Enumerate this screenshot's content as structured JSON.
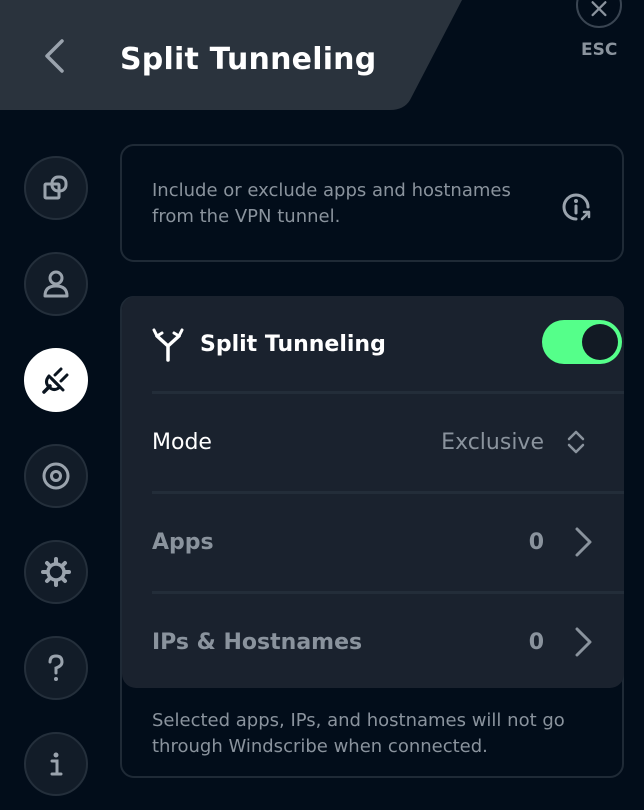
{
  "header": {
    "title": "Split Tunneling",
    "esc_label": "ESC",
    "back_icon": "chevron-left-icon",
    "close_icon": "close-icon"
  },
  "sidebar": {
    "items": [
      {
        "id": "connection",
        "icon": "windows-stack-icon",
        "active": false
      },
      {
        "id": "account",
        "icon": "user-icon",
        "active": false
      },
      {
        "id": "connection-settings",
        "icon": "plug-icon",
        "active": true
      },
      {
        "id": "robert",
        "icon": "robert-icon",
        "active": false
      },
      {
        "id": "general",
        "icon": "gear-icon",
        "active": false
      },
      {
        "id": "help",
        "icon": "question-icon",
        "active": false
      },
      {
        "id": "about",
        "icon": "info-icon",
        "active": false
      }
    ]
  },
  "info": {
    "text": "Include or exclude apps and hostnames from the VPN tunnel.",
    "icon": "info-external-icon"
  },
  "split_tunneling": {
    "title": "Split Tunneling",
    "enabled": true,
    "toggle_color": "#55ff8a",
    "mode_label": "Mode",
    "mode_value": "Exclusive",
    "apps_label": "Apps",
    "apps_count": "0",
    "hosts_label": "IPs & Hostnames",
    "hosts_count": "0"
  },
  "footer": {
    "note": "Selected apps, IPs, and hostnames will not go through Windscribe when connected."
  },
  "colors": {
    "background": "#020d1a",
    "header": "#2a333d",
    "card": "#1a222e",
    "accent": "#55ff8a",
    "muted_text": "#8a939d"
  }
}
